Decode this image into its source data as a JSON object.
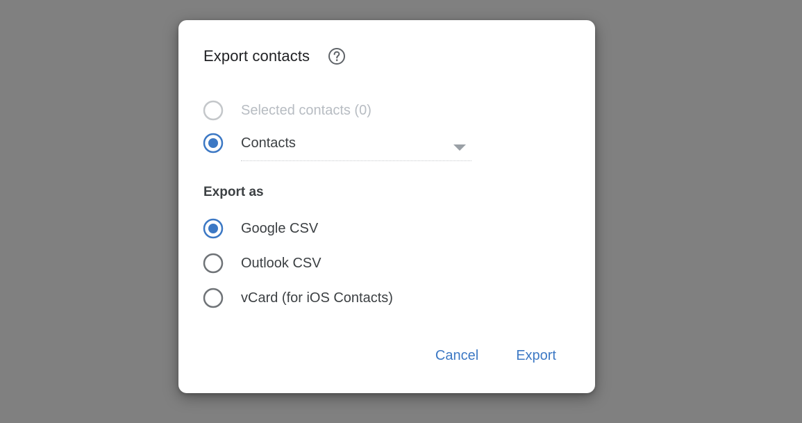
{
  "dialog": {
    "title": "Export contacts",
    "help_icon": "help-circle-icon"
  },
  "source": {
    "selected_label": "Selected contacts (0)",
    "selected_disabled": true,
    "group_label_selected": true,
    "group_value": "Contacts"
  },
  "format": {
    "heading": "Export as",
    "options": [
      {
        "label": "Google CSV",
        "selected": true
      },
      {
        "label": "Outlook CSV",
        "selected": false
      },
      {
        "label": "vCard (for iOS Contacts)",
        "selected": false
      }
    ]
  },
  "actions": {
    "cancel_label": "Cancel",
    "export_label": "Export"
  },
  "colors": {
    "accent": "#3c78c4",
    "overlay": "#808080",
    "disabled_text": "#b7bcc2",
    "text": "#3c4043"
  }
}
